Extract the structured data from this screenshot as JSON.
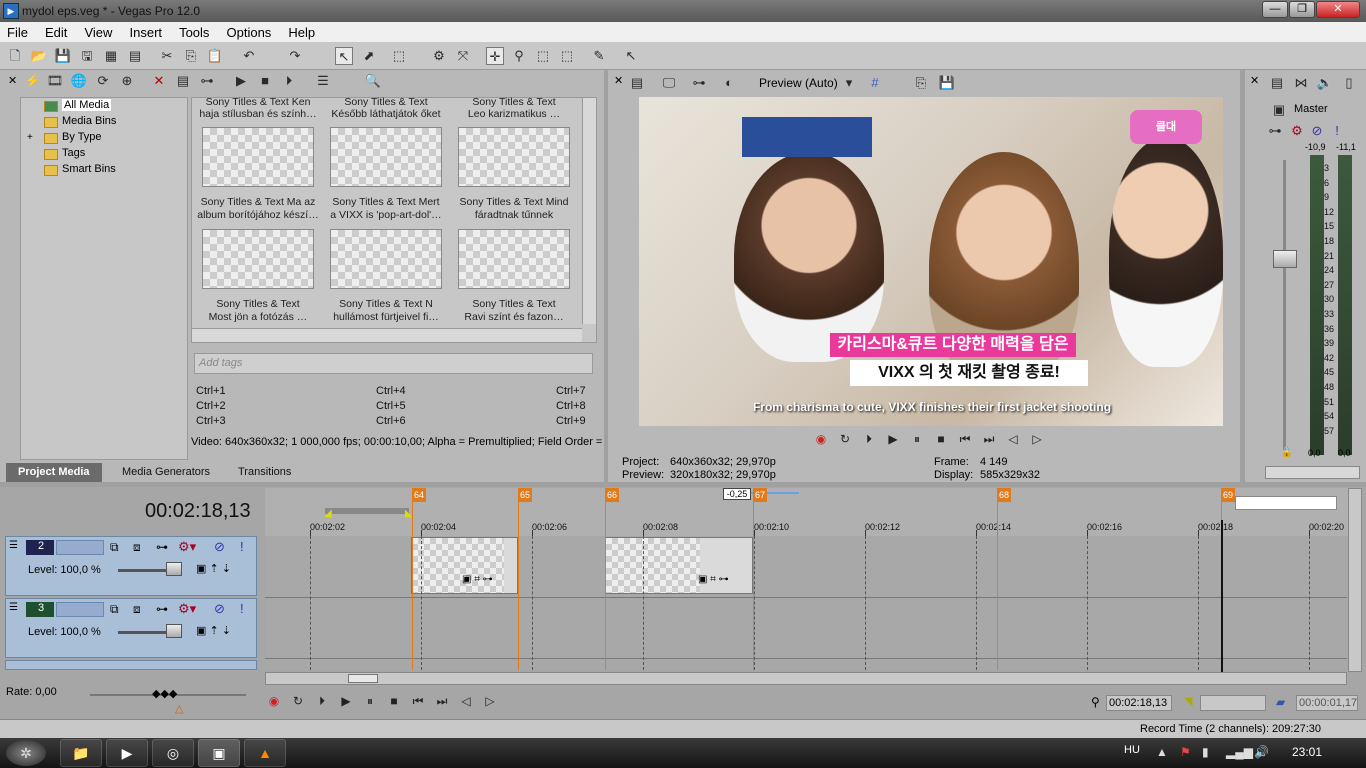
{
  "window": {
    "title": "mydol eps.veg * - Vegas Pro 12.0",
    "min": "—",
    "max": "❐",
    "close": "✕"
  },
  "menu": [
    "File",
    "Edit",
    "View",
    "Insert",
    "Tools",
    "Options",
    "Help"
  ],
  "explorer": {
    "tree": [
      "All Media",
      "Media Bins",
      "By Type",
      "Tags",
      "Smart Bins"
    ],
    "expand": "+",
    "thumbs": [
      {
        "l1": "Sony Titles & Text Ken",
        "l2": "haja stílusban és szính…"
      },
      {
        "l1": "Sony Titles & Text",
        "l2": "Később láthatjátok őket"
      },
      {
        "l1": "Sony Titles & Text",
        "l2": "Leo karizmatikus …"
      },
      {
        "l1": "Sony Titles & Text Ma az",
        "l2": "album borítójához készí…"
      },
      {
        "l1": "Sony Titles & Text Mert",
        "l2": "a VIXX is 'pop-art-dol'…"
      },
      {
        "l1": "Sony Titles & Text Mind",
        "l2": "fáradtnak tűnnek"
      },
      {
        "l1": "Sony Titles & Text",
        "l2": "Most jön a fotózás …"
      },
      {
        "l1": "Sony Titles & Text N",
        "l2": "hullámost fürtjeivel fi…"
      },
      {
        "l1": "Sony Titles & Text",
        "l2": "Ravi színt és fazon…"
      }
    ],
    "tag_placeholder": "Add tags",
    "shortcuts": [
      "Ctrl+1",
      "Ctrl+4",
      "Ctrl+7",
      "Ctrl+2",
      "Ctrl+5",
      "Ctrl+8",
      "Ctrl+3",
      "Ctrl+6",
      "Ctrl+9"
    ],
    "video_info": "Video: 640x360x32; 1 000,000 fps; 00:00:10,00; Alpha = Premultiplied; Field Order =",
    "tabs": [
      "Project Media",
      "Media Generators",
      "Transitions"
    ]
  },
  "preview": {
    "quality": "Preview (Auto)",
    "subtitle_kr1": "카리스마&큐트 다양한 매력을 담은",
    "subtitle_kr2": "VIXX 의 첫 재킷 촬영 종료!",
    "subtitle_en": "From charisma to cute, VIXX finishes their first jacket shooting",
    "logo_right": "클대",
    "project_label": "Project:",
    "project_value": "640x360x32; 29,970p",
    "preview_label": "Preview:",
    "preview_value": "320x180x32; 29,970p",
    "frame_label": "Frame:",
    "frame_value": "4 149",
    "display_label": "Display:",
    "display_value": "585x329x32"
  },
  "mixer": {
    "title": "Master",
    "peak_left": "-10,9",
    "peak_right": "-11,1",
    "ticks": [
      "3",
      "6",
      "9",
      "12",
      "15",
      "18",
      "21",
      "24",
      "27",
      "30",
      "33",
      "36",
      "39",
      "42",
      "45",
      "48",
      "51",
      "54",
      "57"
    ],
    "bottom_left": "0,0",
    "bottom_right": "0,0"
  },
  "timeline": {
    "timecode": "00:02:18,13",
    "markers": [
      "64",
      "65",
      "66",
      "67",
      "68",
      "69"
    ],
    "ruler_times": [
      "00:02:02",
      "00:02:04",
      "00:02:06",
      "00:02:08",
      "00:02:10",
      "00:02:12",
      "00:02:14",
      "00:02:16",
      "00:02:18",
      "00:02:20"
    ],
    "offset_label": "-0,25",
    "tracks": [
      {
        "num": "2",
        "level_label": "Level: 100,0 %"
      },
      {
        "num": "3",
        "level_label": "Level: 100,0 %"
      }
    ],
    "rate": "Rate: 0,00",
    "cursor_time": "00:02:18,13",
    "length_time": "00:00:01,17",
    "record_time": "Record Time (2 channels): 209:27:30"
  },
  "taskbar": {
    "lang": "HU",
    "clock": "23:01"
  }
}
